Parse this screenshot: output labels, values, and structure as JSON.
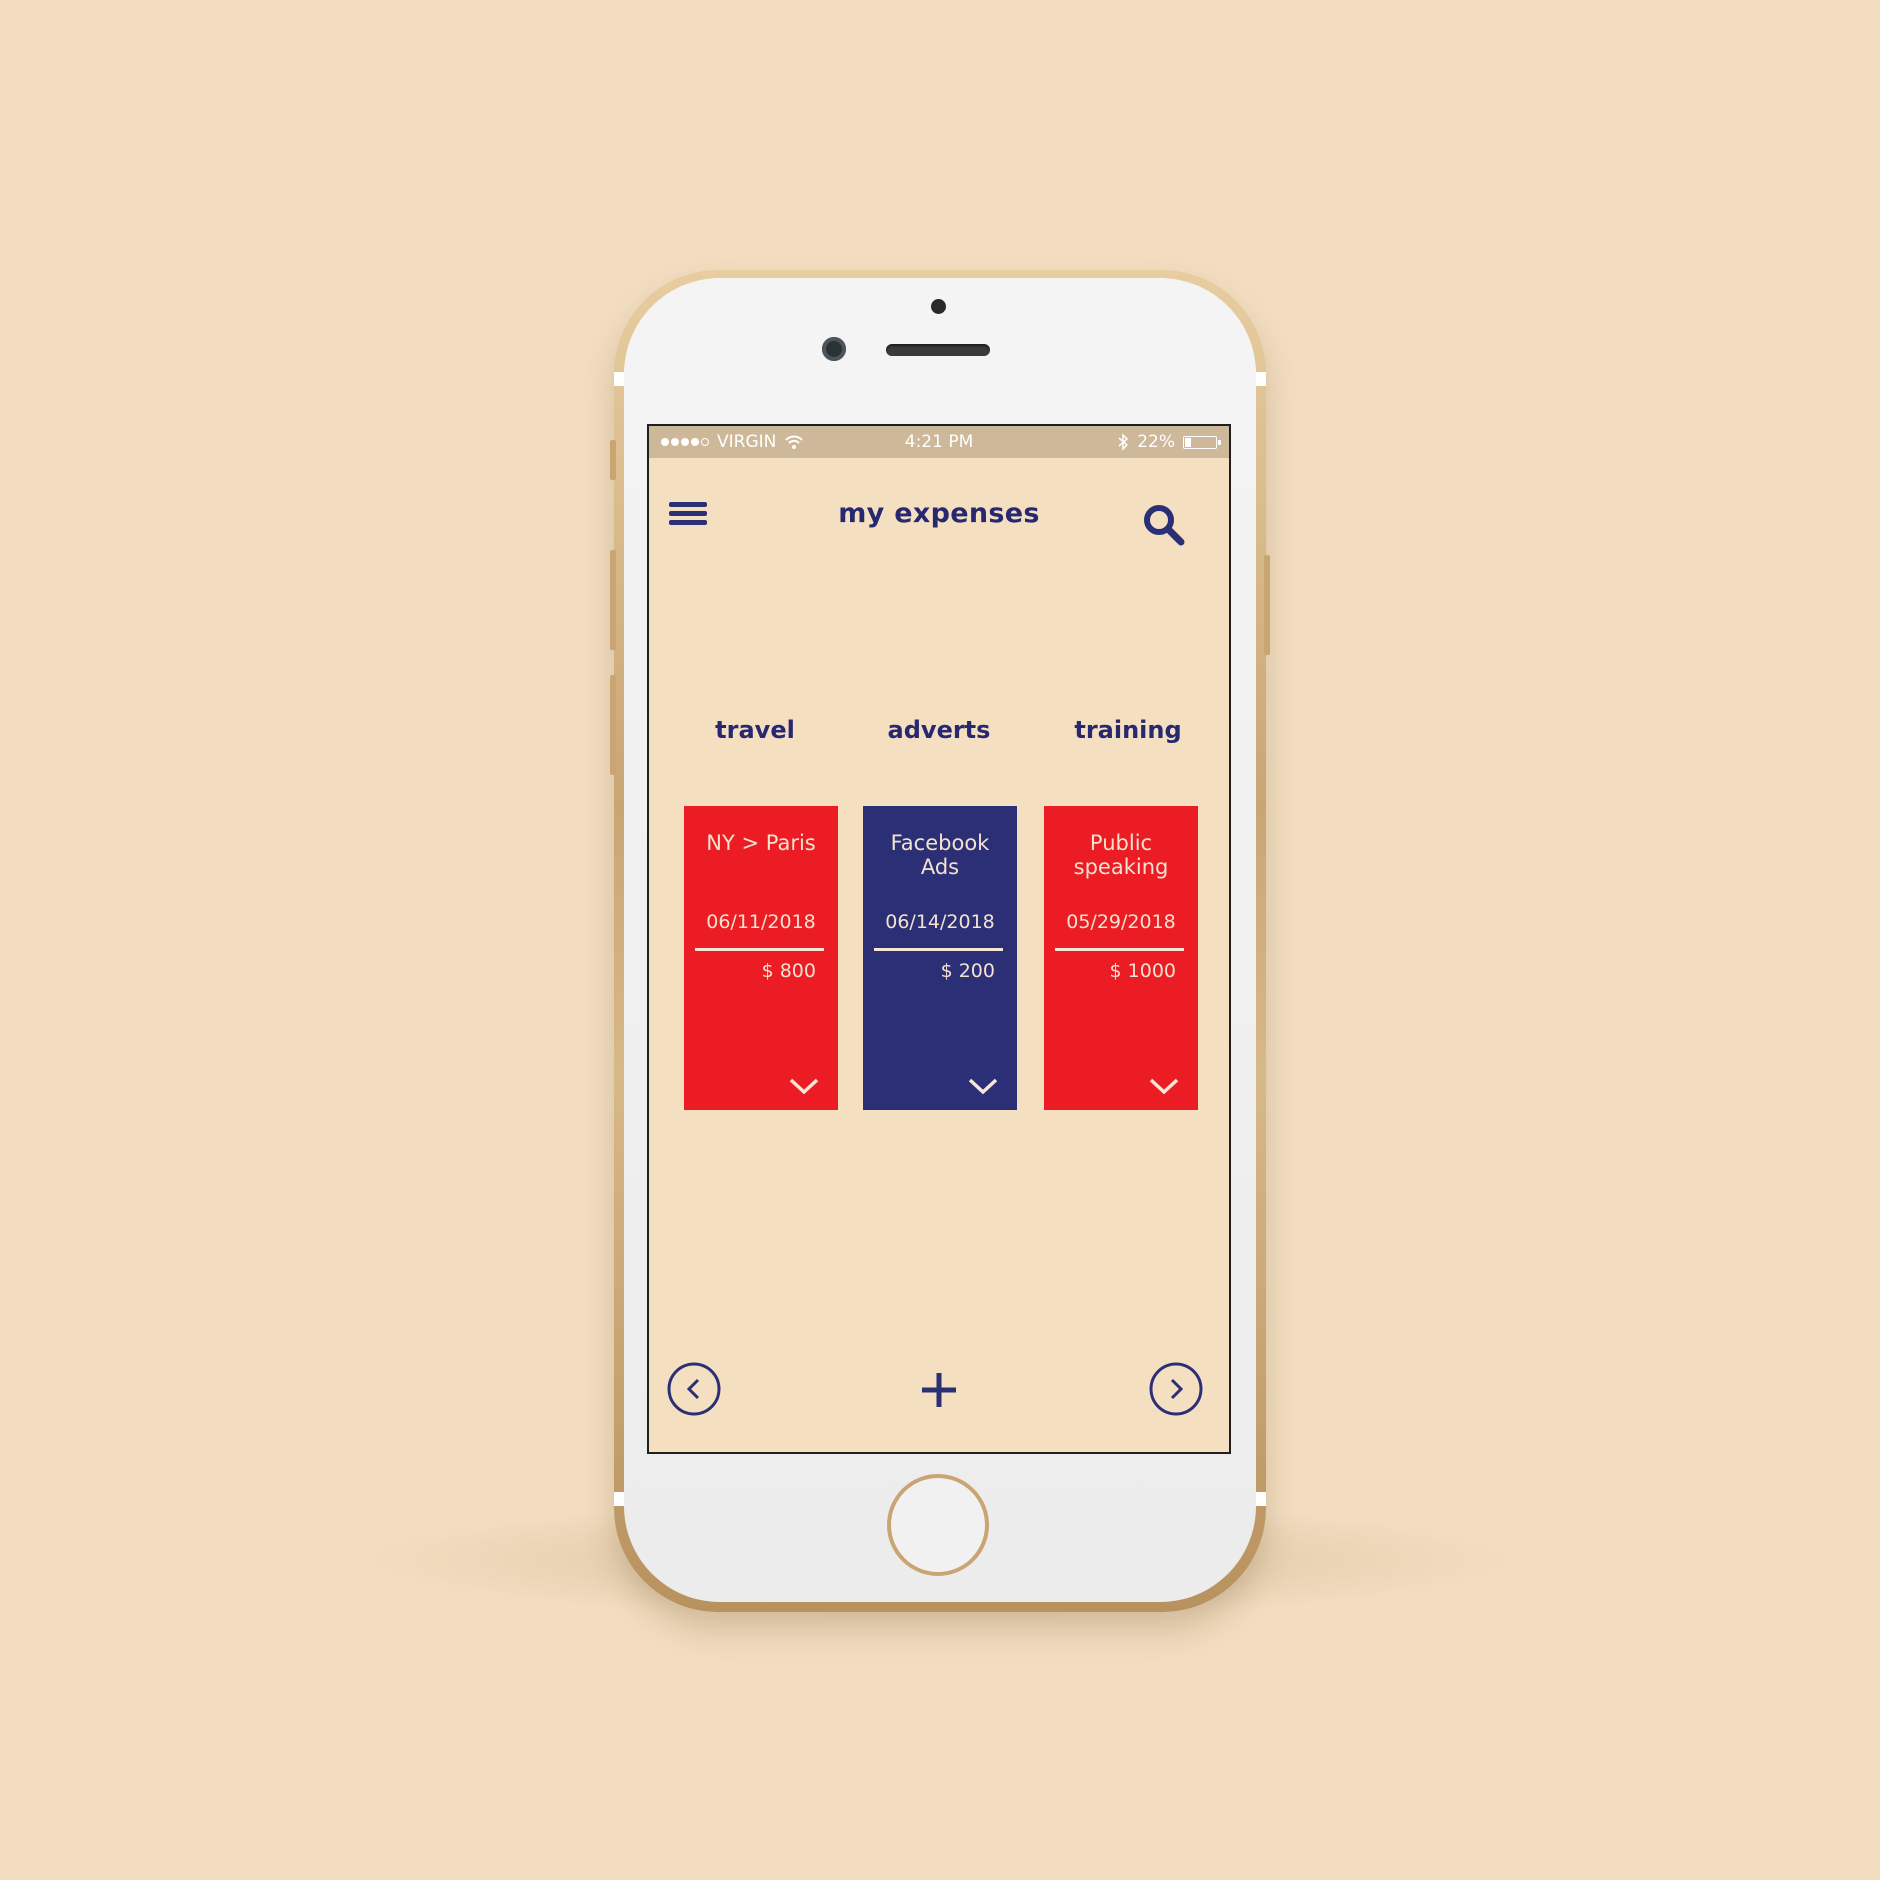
{
  "status_bar": {
    "carrier": "VIRGIN",
    "time": "4:21 PM",
    "battery": "22%",
    "battery_level": 0.22,
    "signal_bars_filled": 4,
    "signal_bars_total": 5
  },
  "header": {
    "title": "my expenses",
    "menu_icon": "hamburger-menu-icon",
    "search_icon": "search-icon"
  },
  "categories": [
    "travel",
    "adverts",
    "training"
  ],
  "cards": [
    {
      "title": "NY > Paris",
      "date": "06/11/2018",
      "amount": "$ 800",
      "color": "#ec1c24"
    },
    {
      "title": "Facebook Ads",
      "date": "06/14/2018",
      "amount": "$ 200",
      "color": "#2b2f76"
    },
    {
      "title": "Public speaking",
      "date": "05/29/2018",
      "amount": "$ 1000",
      "color": "#ec1c24"
    }
  ],
  "footer": {
    "prev_icon": "chevron-left-circle-icon",
    "add_icon": "plus-icon",
    "next_icon": "chevron-right-circle-icon"
  },
  "colors": {
    "background": "#f2ddc0",
    "screen": "#f5dfc1",
    "status_bar": "#ceb89a",
    "accent_navy": "#27286f",
    "accent_red": "#ec1c24",
    "phone_gold": "#c9a574"
  }
}
